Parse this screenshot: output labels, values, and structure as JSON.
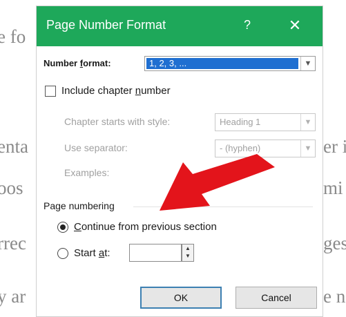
{
  "background_text": [
    "e fo",
    "enta",
    "er i",
    "oos",
    "mi",
    "rrec",
    "ges",
    "y ar",
    "e n"
  ],
  "dialog": {
    "title": "Page Number Format",
    "help": "?",
    "close": "✕",
    "number_format": {
      "label_pre": "Number ",
      "label_accel": "f",
      "label_post": "ormat:",
      "value": "1, 2, 3, ..."
    },
    "include_chapter": {
      "label_pre": "Include chapter ",
      "label_accel": "n",
      "label_post": "umber",
      "checked": false
    },
    "chapter_style": {
      "label": "Chapter starts with style:",
      "value": "Heading 1"
    },
    "separator": {
      "label": "Use separator:",
      "value": "-   (hyphen)"
    },
    "examples": {
      "label": "Examples:"
    },
    "page_numbering": {
      "heading": "Page numbering",
      "continue": {
        "label_accel": "C",
        "label_post": "ontinue from previous section",
        "selected": true
      },
      "start_at": {
        "label_pre": "Start ",
        "label_accel": "a",
        "label_post": "t:",
        "selected": false,
        "value": ""
      }
    },
    "ok": "OK",
    "cancel": "Cancel"
  },
  "colors": {
    "titlebar": "#1ea85a",
    "selection": "#1f6fd1",
    "arrow": "#e3141b"
  }
}
